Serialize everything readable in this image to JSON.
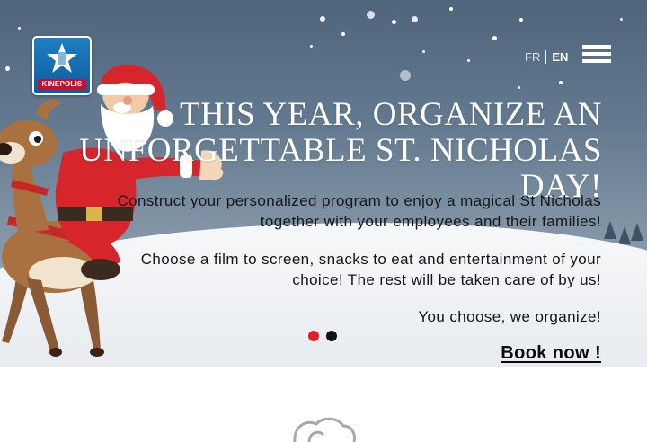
{
  "header": {
    "logo_text": "KINEPOLIS",
    "languages": [
      {
        "label": "FR",
        "active": false
      },
      {
        "label": "EN",
        "active": true
      }
    ],
    "menu_icon": "hamburger-menu-icon"
  },
  "hero": {
    "title_line1": "THIS YEAR, ORGANIZE AN",
    "title_line2": "UNFORGETTABLE ST. NICHOLAS DAY!",
    "paragraph1_line1": "Construct your personalized program to enjoy a magical St Nicholas",
    "paragraph1_line2": "together with your employees and their families!",
    "paragraph2_line1": "Choose a film to screen, snacks to eat and entertainment of your",
    "paragraph2_line2": "choice! The rest will be taken care of by us!",
    "paragraph3": "You choose, we organize!",
    "cta": "Book now !",
    "illustration": "santa-on-reindeer-illustration",
    "slides": 2,
    "active_slide": 1
  },
  "colors": {
    "brand_blue": "#1d7ec2",
    "brand_red": "#c8102e",
    "active_dot": "#e51d2a",
    "sky": "#5b7189"
  },
  "below_fold": {
    "icon": "cloud-outline-icon"
  }
}
